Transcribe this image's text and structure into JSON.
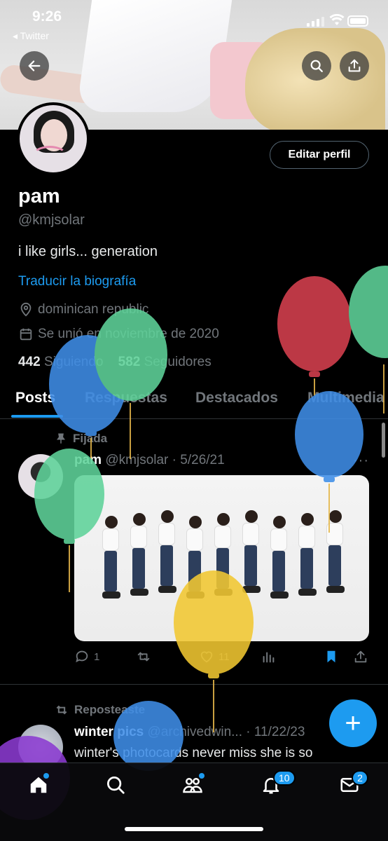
{
  "status": {
    "time": "9:26",
    "back_app": "◂ Twitter"
  },
  "profile": {
    "edit_label": "Editar perfil",
    "name": "pam",
    "handle": "@kmjsolar",
    "bio": "i like girls... generation",
    "translate": "Traducir la biografía",
    "location": "dominican republic",
    "joined": "Se unió en noviembre de 2020",
    "following_count": "442",
    "following_label": "Siguiendo",
    "followers_count": "582",
    "followers_label": "Seguidores"
  },
  "tabs": [
    "Posts",
    "Respuestas",
    "Destacados",
    "Multimedia"
  ],
  "post1": {
    "pinned_label": "Fijada",
    "author": "pam",
    "handle": "@kmjsolar",
    "date": "· 5/26/21",
    "reply_count": "1",
    "like_count": "11"
  },
  "post2": {
    "repost_label": "Reposteaste",
    "author": "winter pics",
    "handle": "@archivedwin...",
    "date": "· 11/22/23",
    "text": "winter's photocards never miss she is so"
  },
  "nav": {
    "notifications_badge": "10",
    "messages_badge": "2"
  },
  "colors": {
    "accent": "#1d9bf0",
    "balloon_red": "#d6404f",
    "balloon_green": "#5fd39a",
    "balloon_blue": "#3f8ee8",
    "balloon_yellow": "#f2c832",
    "balloon_purple": "#8b3bd1"
  }
}
